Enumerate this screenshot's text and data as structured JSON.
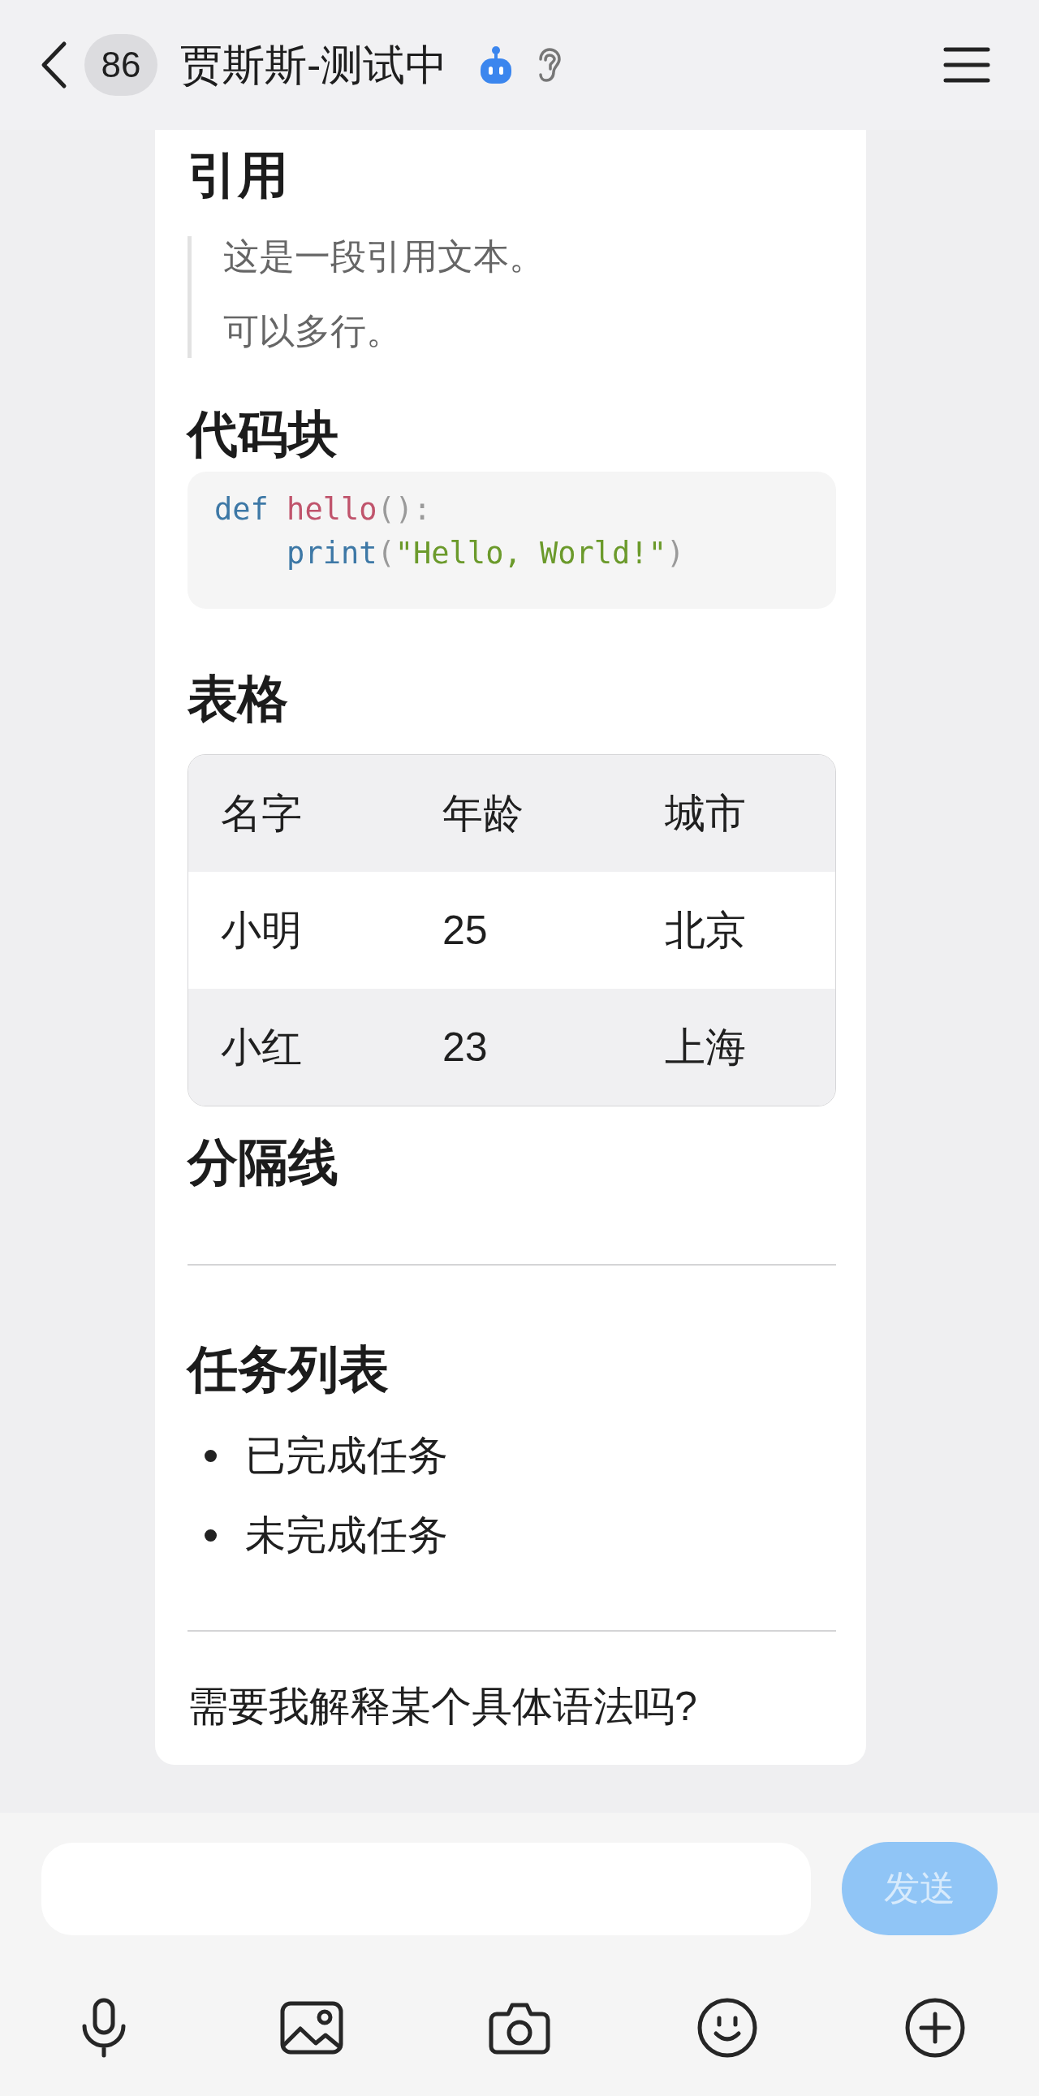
{
  "header": {
    "unread_count": "86",
    "title": "贾斯斯-测试中"
  },
  "message": {
    "blocks": [
      {
        "kind": "heading",
        "text": "引用"
      },
      {
        "kind": "quote",
        "lines": [
          "这是一段引用文本。",
          "可以多行。"
        ]
      },
      {
        "kind": "heading",
        "text": "代码块"
      },
      {
        "kind": "code",
        "lines": [
          {
            "tokens": [
              {
                "kind": "keyword",
                "text": "def"
              },
              {
                "kind": "function",
                "text": " hello"
              },
              {
                "kind": "punctuation",
                "text": "():"
              }
            ]
          },
          {
            "tokens": [
              {
                "kind": "builtin",
                "text": "    print"
              },
              {
                "kind": "punctuation",
                "text": "("
              },
              {
                "kind": "string",
                "text": "\"Hello, World!\""
              },
              {
                "kind": "punctuation",
                "text": ")"
              }
            ]
          }
        ]
      },
      {
        "kind": "heading",
        "text": "表格"
      },
      {
        "kind": "table",
        "columns": [
          "名字",
          "年龄",
          "城市"
        ],
        "rows": [
          [
            "小明",
            "25",
            "北京"
          ],
          [
            "小红",
            "23",
            "上海"
          ]
        ]
      },
      {
        "kind": "heading",
        "text": "分隔线"
      },
      {
        "kind": "rule"
      },
      {
        "kind": "heading",
        "text": "任务列表"
      },
      {
        "kind": "list",
        "items": [
          "已完成任务",
          "未完成任务"
        ]
      },
      {
        "kind": "rule"
      },
      {
        "kind": "paragraph",
        "text": "需要我解释某个具体语法吗?"
      }
    ]
  },
  "composer": {
    "send": {
      "label": "发送",
      "disabled": true
    }
  }
}
